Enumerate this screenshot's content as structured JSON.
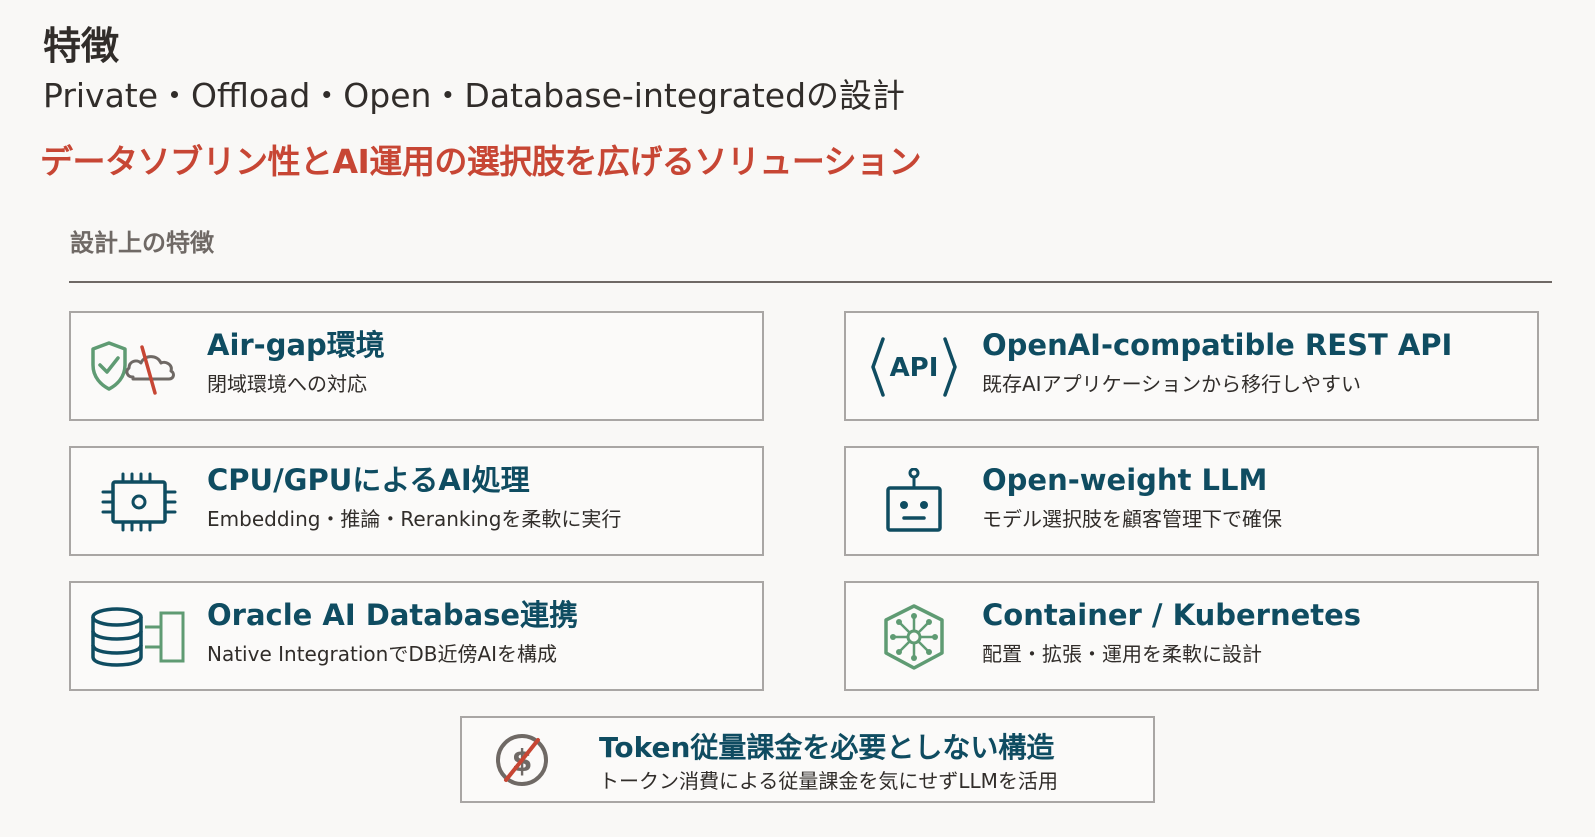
{
  "header": {
    "title": "特徴",
    "subtitle": "Private・Offload・Open・Database-integratedの設計",
    "tagline": "データソブリン性とAI運用の選択肢を広げるソリューション"
  },
  "section": {
    "label": "設計上の特徴"
  },
  "features": [
    {
      "icon": "shield-no-cloud-icon",
      "title": "Air-gap環境",
      "desc": "閉域環境への対応"
    },
    {
      "icon": "api-icon",
      "title": "OpenAI-compatible REST API",
      "desc": "既存AIアプリケーションから移行しやすい"
    },
    {
      "icon": "cpu-chip-icon",
      "title": "CPU/GPUによるAI処理",
      "desc": "Embedding・推論・Rerankingを柔軟に実行"
    },
    {
      "icon": "robot-icon",
      "title": "Open-weight LLM",
      "desc": "モデル選択肢を顧客管理下で確保"
    },
    {
      "icon": "database-integration-icon",
      "title": "Oracle AI Database連携",
      "desc": "Native IntegrationでDB近傍AIを構成"
    },
    {
      "icon": "kubernetes-icon",
      "title": "Container / Kubernetes",
      "desc": "配置・拡張・運用を柔軟に設計"
    },
    {
      "icon": "no-dollar-icon",
      "title": "Token従量課金を必要としない構造",
      "desc": "トークン消費による従量課金を気にせずLLMを活用"
    }
  ],
  "colors": {
    "accent_red": "#c74634",
    "title_teal": "#0f4c61",
    "icon_green": "#5f9b73",
    "card_border": "#a9a6a4",
    "background": "#f9f8f6"
  }
}
